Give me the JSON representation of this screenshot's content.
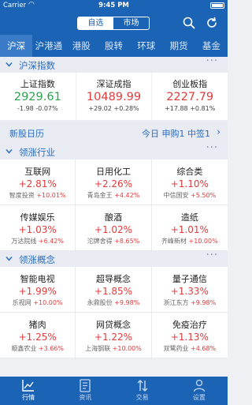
{
  "status": {
    "carrier": "Carrier",
    "time": "9:45 PM"
  },
  "nav": {
    "seg_selected": "自选",
    "seg_market": "市场",
    "search_icon": "search-icon",
    "refresh_icon": "refresh-icon"
  },
  "tabs": [
    {
      "label": "沪深",
      "active": true
    },
    {
      "label": "沪港通"
    },
    {
      "label": "港股"
    },
    {
      "label": "股转"
    },
    {
      "label": "环球"
    },
    {
      "label": "期货"
    },
    {
      "label": "基金"
    }
  ],
  "sections": {
    "indices": {
      "title": "沪深指数",
      "more": "···",
      "items": [
        {
          "name": "上证指数",
          "value": "2929.61",
          "change": "-1.98",
          "pct": "-0.07%",
          "dir": "down"
        },
        {
          "name": "深证成指",
          "value": "10489.99",
          "change": "+29.02",
          "pct": "+0.28%",
          "dir": "up"
        },
        {
          "name": "创业板指",
          "value": "2227.79",
          "change": "+17.88",
          "pct": "+0.81%",
          "dir": "up"
        }
      ]
    },
    "ipo": {
      "label": "新股日历",
      "info": "今日 申购1 中签1",
      "arrow": "›"
    },
    "industry": {
      "title": "领涨行业",
      "more": "···",
      "items": [
        {
          "name": "互联网",
          "pct": "+2.81%",
          "stock": "智度投资",
          "stock_pct": "+10.01%"
        },
        {
          "name": "日用化工",
          "pct": "+2.26%",
          "stock": "青岛金王",
          "stock_pct": "+4.42%"
        },
        {
          "name": "综合类",
          "pct": "+1.10%",
          "stock": "中信国安",
          "stock_pct": "+5.50%"
        },
        {
          "name": "传媒娱乐",
          "pct": "+1.03%",
          "stock": "万达院线",
          "stock_pct": "+6.42%"
        },
        {
          "name": "酿酒",
          "pct": "+1.02%",
          "stock": "沱牌舍得",
          "stock_pct": "+8.65%"
        },
        {
          "name": "造纸",
          "pct": "+1.01%",
          "stock": "齐峰新材",
          "stock_pct": "+10.00%"
        }
      ]
    },
    "concept": {
      "title": "领涨概念",
      "more": "···",
      "items": [
        {
          "name": "智能电视",
          "pct": "+1.99%",
          "stock": "乐视网",
          "stock_pct": "+10.00%"
        },
        {
          "name": "超导概念",
          "pct": "+1.85%",
          "stock": "永鼎股份",
          "stock_pct": "+9.98%"
        },
        {
          "name": "量子通信",
          "pct": "+1.33%",
          "stock": "浙江东方",
          "stock_pct": "+9.98%"
        },
        {
          "name": "猪肉",
          "pct": "+1.25%",
          "stock": "顺鑫农业",
          "stock_pct": "+3.66%"
        },
        {
          "name": "网贷概念",
          "pct": "+1.22%",
          "stock": "上海钢联",
          "stock_pct": "+10.00%"
        },
        {
          "name": "免疫治疗",
          "pct": "+1.13%",
          "stock": "双鹭药业",
          "stock_pct": "+4.68%"
        }
      ]
    }
  },
  "bottom": [
    {
      "label": "行情",
      "icon": "chart-icon",
      "active": true
    },
    {
      "label": "资讯",
      "icon": "news-icon"
    },
    {
      "label": "交易",
      "icon": "trade-icon"
    },
    {
      "label": "设置",
      "icon": "user-icon"
    }
  ],
  "colors": {
    "brand": "#1b63b5",
    "up": "#e23b3b",
    "down": "#2aa34b"
  }
}
